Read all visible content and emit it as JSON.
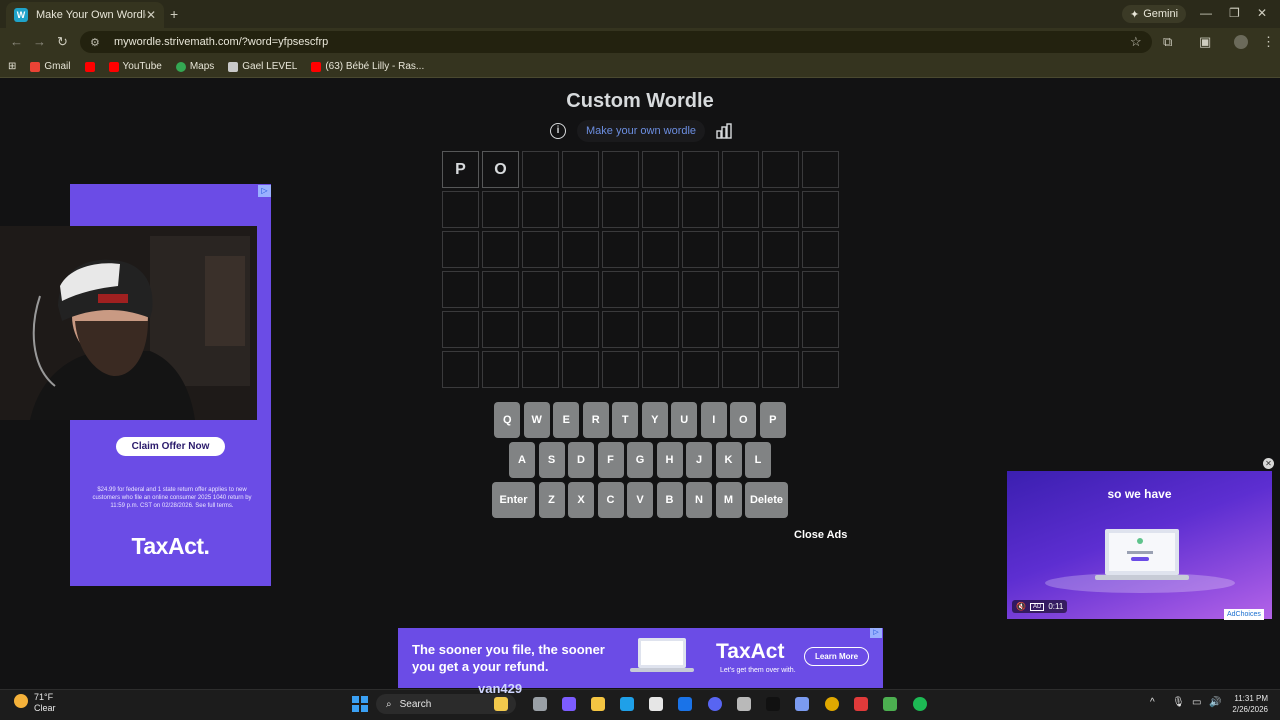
{
  "browser": {
    "tab_title": "Make Your Own Wordle",
    "tab_favicon": "W",
    "new_tab": "+",
    "gemini": "Gemini",
    "url": "mywordle.strivemath.com/?word=yfpsescfrp",
    "bookmarks": [
      "Gmail",
      "YouTube",
      "Maps",
      "Gael LEVEL",
      "(63) Bébé Lilly - Ras..."
    ]
  },
  "game": {
    "title": "Custom Wordle",
    "make_own": "Make your own wordle",
    "columns": 10,
    "rows": 6,
    "guess_letters": [
      "P",
      "O"
    ],
    "keyboard": {
      "row1": [
        "Q",
        "W",
        "E",
        "R",
        "T",
        "Y",
        "U",
        "I",
        "O",
        "P"
      ],
      "row2": [
        "A",
        "S",
        "D",
        "F",
        "G",
        "H",
        "J",
        "K",
        "L"
      ],
      "row3": [
        "Enter",
        "Z",
        "X",
        "C",
        "V",
        "B",
        "N",
        "M",
        "Delete"
      ]
    },
    "close_ads": "Close Ads"
  },
  "ads": {
    "left": {
      "cta": "Claim Offer Now",
      "fine_print": "$24.99 for federal and 1 state return offer applies to new customers who file an online consumer 2025 1040 return by 11:59 p.m. CST on 02/28/2026. See full terms.",
      "brand": "TaxAct."
    },
    "right": {
      "caption": "so we have",
      "time": "0:11",
      "ad_label": "AD",
      "adchoices": "AdChoices"
    },
    "bottom": {
      "headline": "The sooner you file, the sooner you get a your refund.",
      "brand": "TaxAct",
      "tagline": "Let's get them over with.",
      "cta": "Learn More"
    }
  },
  "overlay_name": "van429",
  "taskbar": {
    "temp": "71°F",
    "weather": "Clear",
    "search": "Search",
    "time": "11:31 PM",
    "date": "2/26/2026"
  }
}
